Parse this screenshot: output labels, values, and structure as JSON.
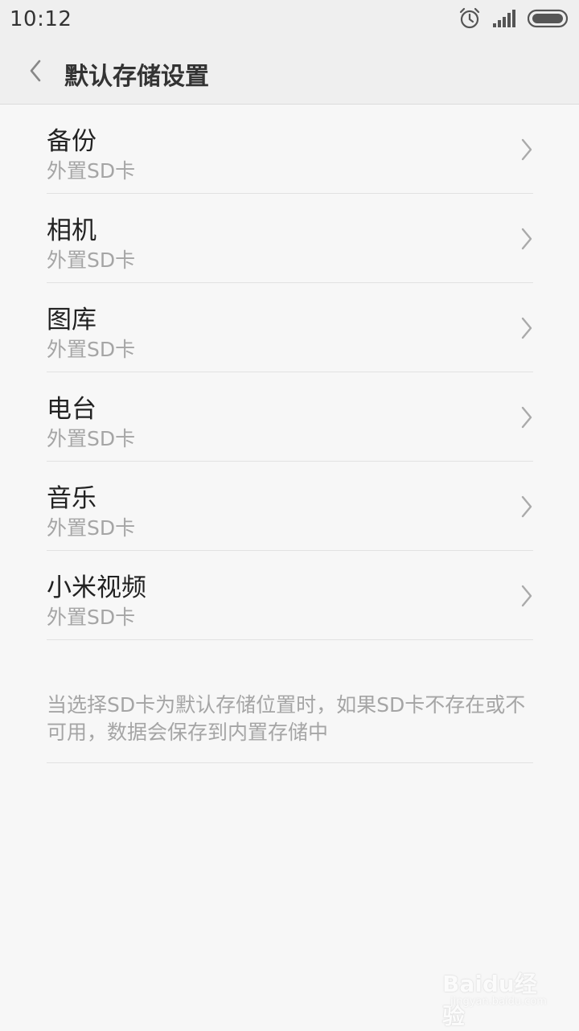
{
  "status_bar": {
    "time": "10:12",
    "icons": [
      "alarm-icon",
      "signal-icon",
      "battery-icon"
    ]
  },
  "header": {
    "title": "默认存储设置",
    "back_icon": "chevron-left-icon"
  },
  "items": [
    {
      "title": "备份",
      "subtitle": "外置SD卡"
    },
    {
      "title": "相机",
      "subtitle": "外置SD卡"
    },
    {
      "title": "图库",
      "subtitle": "外置SD卡"
    },
    {
      "title": "电台",
      "subtitle": "外置SD卡"
    },
    {
      "title": "音乐",
      "subtitle": "外置SD卡"
    },
    {
      "title": "小米视频",
      "subtitle": "外置SD卡"
    }
  ],
  "note": "当选择SD卡为默认存储位置时，如果SD卡不存在或不可用，数据会保存到内置存储中",
  "watermark": {
    "brand": "Baidu经验",
    "url": "jingyan.baidu.com"
  },
  "colors": {
    "background": "#f7f7f7",
    "header_background": "#efefef",
    "title_text": "#222222",
    "secondary_text": "#a5a5a5",
    "divider": "#e2e2e2"
  }
}
